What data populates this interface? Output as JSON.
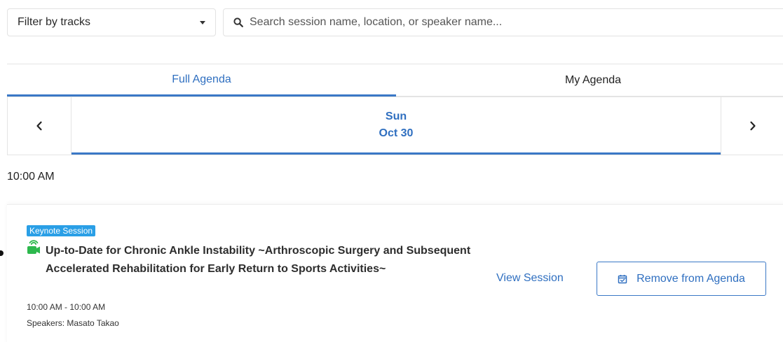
{
  "filter": {
    "label": "Filter by tracks",
    "icon": "caret-down-icon"
  },
  "search": {
    "placeholder": "Search session name, location, or speaker name...",
    "value": "",
    "icon": "search-icon"
  },
  "tabs": [
    {
      "label": "Full Agenda",
      "active": true
    },
    {
      "label": "My Agenda",
      "active": false
    }
  ],
  "datebar": {
    "prev_icon": "chevron-left-icon",
    "next_icon": "chevron-right-icon",
    "day": "Sun",
    "date": "Oct 30"
  },
  "time_heading": "10:00 AM",
  "session": {
    "badge": "Keynote Session",
    "icon": "live-stream-icon",
    "title": "Up-to-Date for Chronic Ankle Instability ~Arthroscopic Surgery and Subsequent Accelerated Rehabilitation for Early Return to Sports Activities~",
    "time_range": "10:00 AM - 10:00 AM",
    "speakers": "Speakers: Masato Takao",
    "view_label": "View Session",
    "remove_label": "Remove from Agenda",
    "remove_icon": "calendar-check-icon"
  },
  "colors": {
    "accent": "#2f6fc0",
    "badge": "#2a9fe6",
    "live_icon": "#2db84d"
  }
}
